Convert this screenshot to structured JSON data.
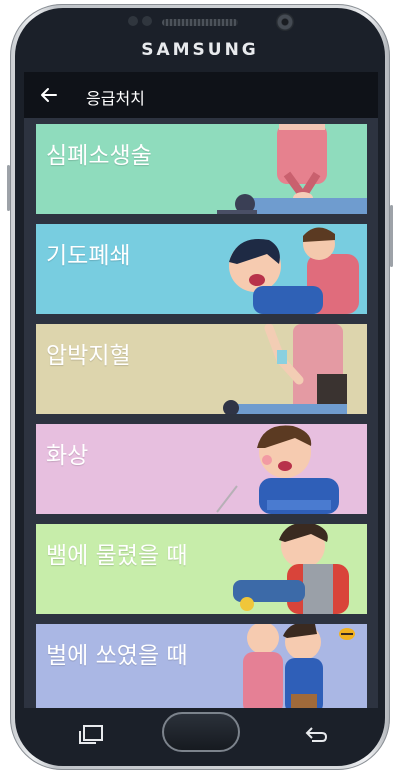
{
  "device": {
    "brand": "SAMSUNG"
  },
  "appbar": {
    "title": "응급처치",
    "back_icon": "arrow-left-icon"
  },
  "menu": {
    "items": [
      {
        "label": "심폐소생술",
        "color": "#8fdcbd"
      },
      {
        "label": "기도폐쇄",
        "color": "#78cde0"
      },
      {
        "label": "압박지혈",
        "color": "#ddd5ad"
      },
      {
        "label": "화상",
        "color": "#e7bfdf"
      },
      {
        "label": "뱀에 물렸을 때",
        "color": "#c7edaa"
      },
      {
        "label": "벌에 쏘였을 때",
        "color": "#aab7e4"
      }
    ]
  },
  "navbar": {
    "recent_icon": "recent-apps-icon",
    "home_icon": "home-button",
    "back_icon": "back-icon"
  }
}
